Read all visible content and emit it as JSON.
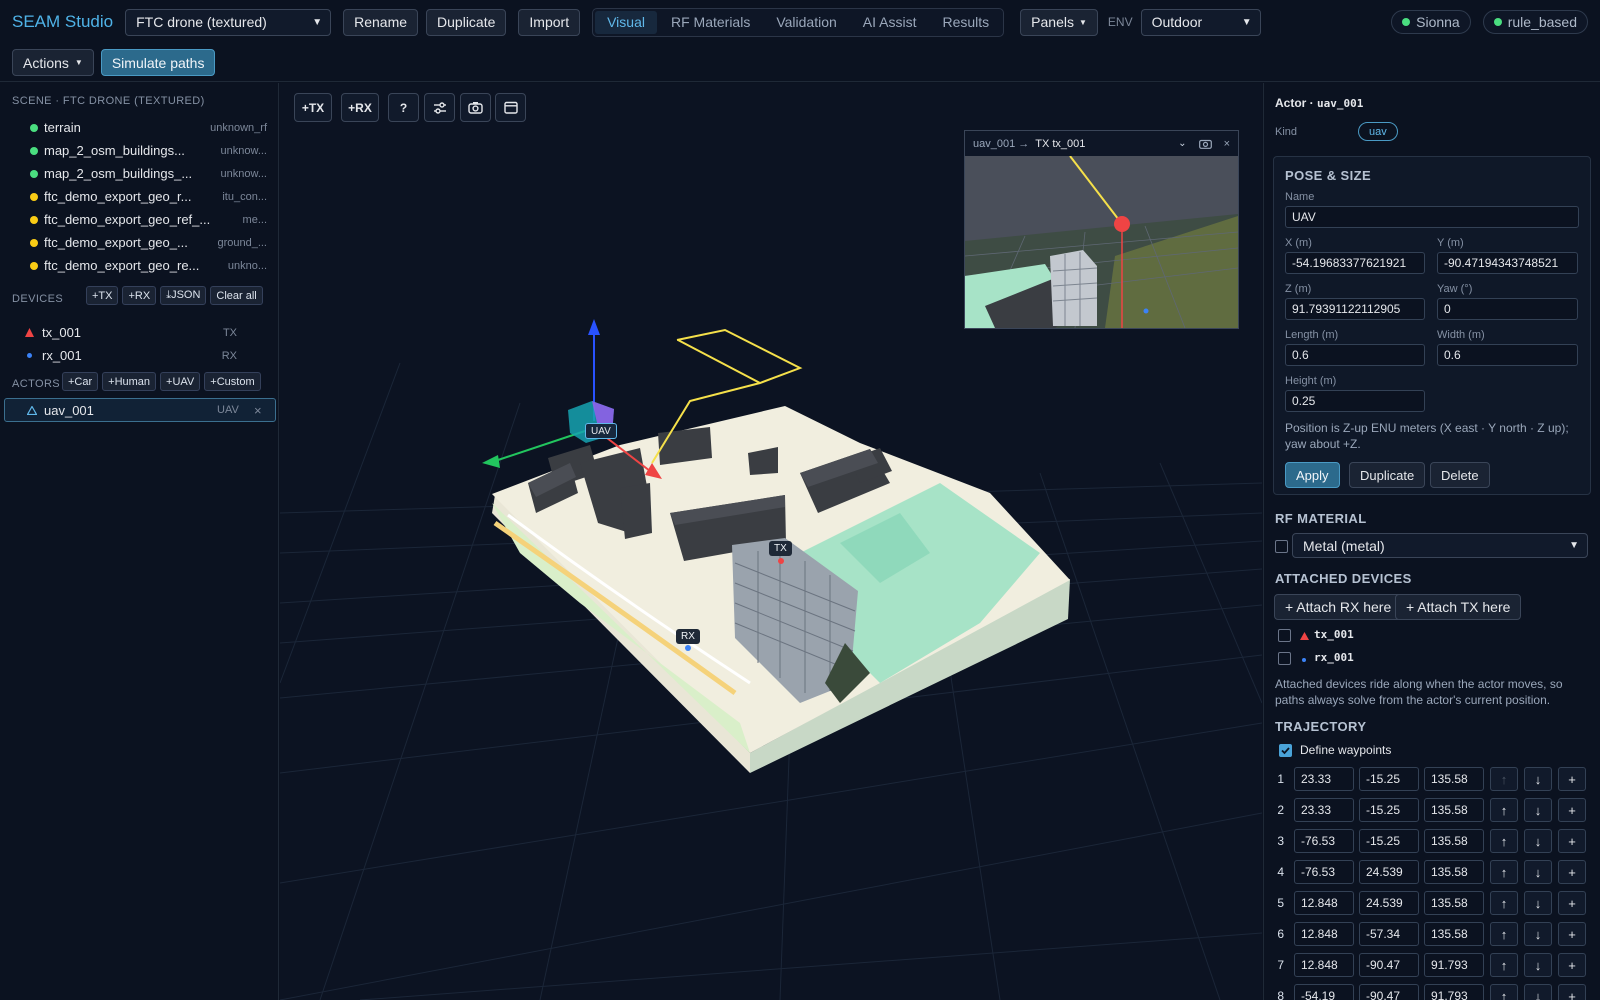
{
  "app": {
    "title": "SEAM Studio"
  },
  "toolbar": {
    "scene_select": "FTC drone (textured)",
    "rename": "Rename",
    "duplicate": "Duplicate",
    "import": "Import",
    "tabs": [
      "Visual",
      "RF Materials",
      "Validation",
      "AI Assist",
      "Results"
    ],
    "active_tab": "Visual",
    "panels": "Panels",
    "env_label": "ENV",
    "env_select": "Outdoor",
    "status": [
      {
        "label": "Sionna",
        "color": "#4ade80"
      },
      {
        "label": "rule_based",
        "color": "#4ade80"
      }
    ],
    "actions": "Actions",
    "simulate": "Simulate paths"
  },
  "left": {
    "scene_title": "SCENE · FTC DRONE (TEXTURED)",
    "scene_items": [
      {
        "name": "terrain",
        "tag": "unknown_rf",
        "color": "#4ade80"
      },
      {
        "name": "map_2_osm_buildings...",
        "tag": "unknow...",
        "color": "#4ade80"
      },
      {
        "name": "map_2_osm_buildings_...",
        "tag": "unknow...",
        "color": "#4ade80"
      },
      {
        "name": "ftc_demo_export_geo_r...",
        "tag": "itu_con...",
        "color": "#facc15"
      },
      {
        "name": "ftc_demo_export_geo_ref_...",
        "tag": "me...",
        "color": "#facc15"
      },
      {
        "name": "ftc_demo_export_geo_...",
        "tag": "ground_...",
        "color": "#facc15"
      },
      {
        "name": "ftc_demo_export_geo_re...",
        "tag": "unkno...",
        "color": "#facc15"
      }
    ],
    "devices_title": "DEVICES",
    "device_buttons": [
      "+TX",
      "+RX",
      "⤓JSON",
      "Clear all"
    ],
    "devices": [
      {
        "name": "tx_001",
        "type": "TX",
        "icon": "triangle",
        "color": "#ef4444"
      },
      {
        "name": "rx_001",
        "type": "RX",
        "icon": "dot",
        "color": "#3b82f6"
      }
    ],
    "actors_title": "ACTORS",
    "actor_buttons": [
      "+Car",
      "+Human",
      "+UAV",
      "+Custom"
    ],
    "actors": [
      {
        "name": "uav_001",
        "type": "UAV",
        "close": "×"
      }
    ]
  },
  "viewport": {
    "buttons": [
      "+TX",
      "+RX",
      "?",
      "sliders-icon",
      "camera-icon",
      "calendar-icon"
    ],
    "labels": {
      "uav": "UAV",
      "tx": "TX",
      "rx": "RX"
    },
    "inset": {
      "source": "uav_001 →",
      "target": "TX tx_001"
    }
  },
  "right": {
    "title_prefix": "Actor ·",
    "title_id": "uav_001",
    "kind_label": "Kind",
    "kind_value": "uav",
    "pose_title": "POSE & SIZE",
    "name_label": "Name",
    "name_value": "UAV",
    "x_label": "X (m)",
    "x_value": "-54.19683377621921",
    "y_label": "Y (m)",
    "y_value": "-90.47194343748521",
    "z_label": "Z (m)",
    "z_value": "91.79391122112905",
    "yaw_label": "Yaw (°)",
    "yaw_value": "0",
    "length_label": "Length (m)",
    "length_value": "0.6",
    "width_label": "Width (m)",
    "width_value": "0.6",
    "height_label": "Height (m)",
    "height_value": "0.25",
    "pose_note": "Position is Z-up ENU meters (X east · Y north · Z up); yaw about +Z.",
    "apply": "Apply",
    "duplicate": "Duplicate",
    "delete": "Delete",
    "rf_title": "RF MATERIAL",
    "rf_select": "Metal (metal)",
    "attached_title": "ATTACHED DEVICES",
    "attach_rx": "+ Attach RX here",
    "attach_tx": "+ Attach TX here",
    "attached": [
      {
        "name": "tx_001",
        "icon": "triangle",
        "color": "#ef4444"
      },
      {
        "name": "rx_001",
        "icon": "dot",
        "color": "#3b82f6"
      }
    ],
    "attached_note": "Attached devices ride along when the actor moves, so paths always solve from the actor's current position.",
    "trajectory_title": "TRAJECTORY",
    "define_waypoints": "Define waypoints",
    "waypoints": [
      {
        "n": "1",
        "x": "23.33",
        "y": "-15.25",
        "z": "135.58"
      },
      {
        "n": "2",
        "x": "23.33",
        "y": "-15.25",
        "z": "135.58"
      },
      {
        "n": "3",
        "x": "-76.53",
        "y": "-15.25",
        "z": "135.58"
      },
      {
        "n": "4",
        "x": "-76.53",
        "y": "24.539",
        "z": "135.58"
      },
      {
        "n": "5",
        "x": "12.848",
        "y": "24.539",
        "z": "135.58"
      },
      {
        "n": "6",
        "x": "12.848",
        "y": "-57.34",
        "z": "135.58"
      },
      {
        "n": "7",
        "x": "12.848",
        "y": "-90.47",
        "z": "91.793"
      },
      {
        "n": "8",
        "x": "-54.19",
        "y": "-90.47",
        "z": "91.793"
      }
    ],
    "wp_buttons": {
      "up": "↑",
      "down": "↓",
      "add": "+"
    }
  }
}
